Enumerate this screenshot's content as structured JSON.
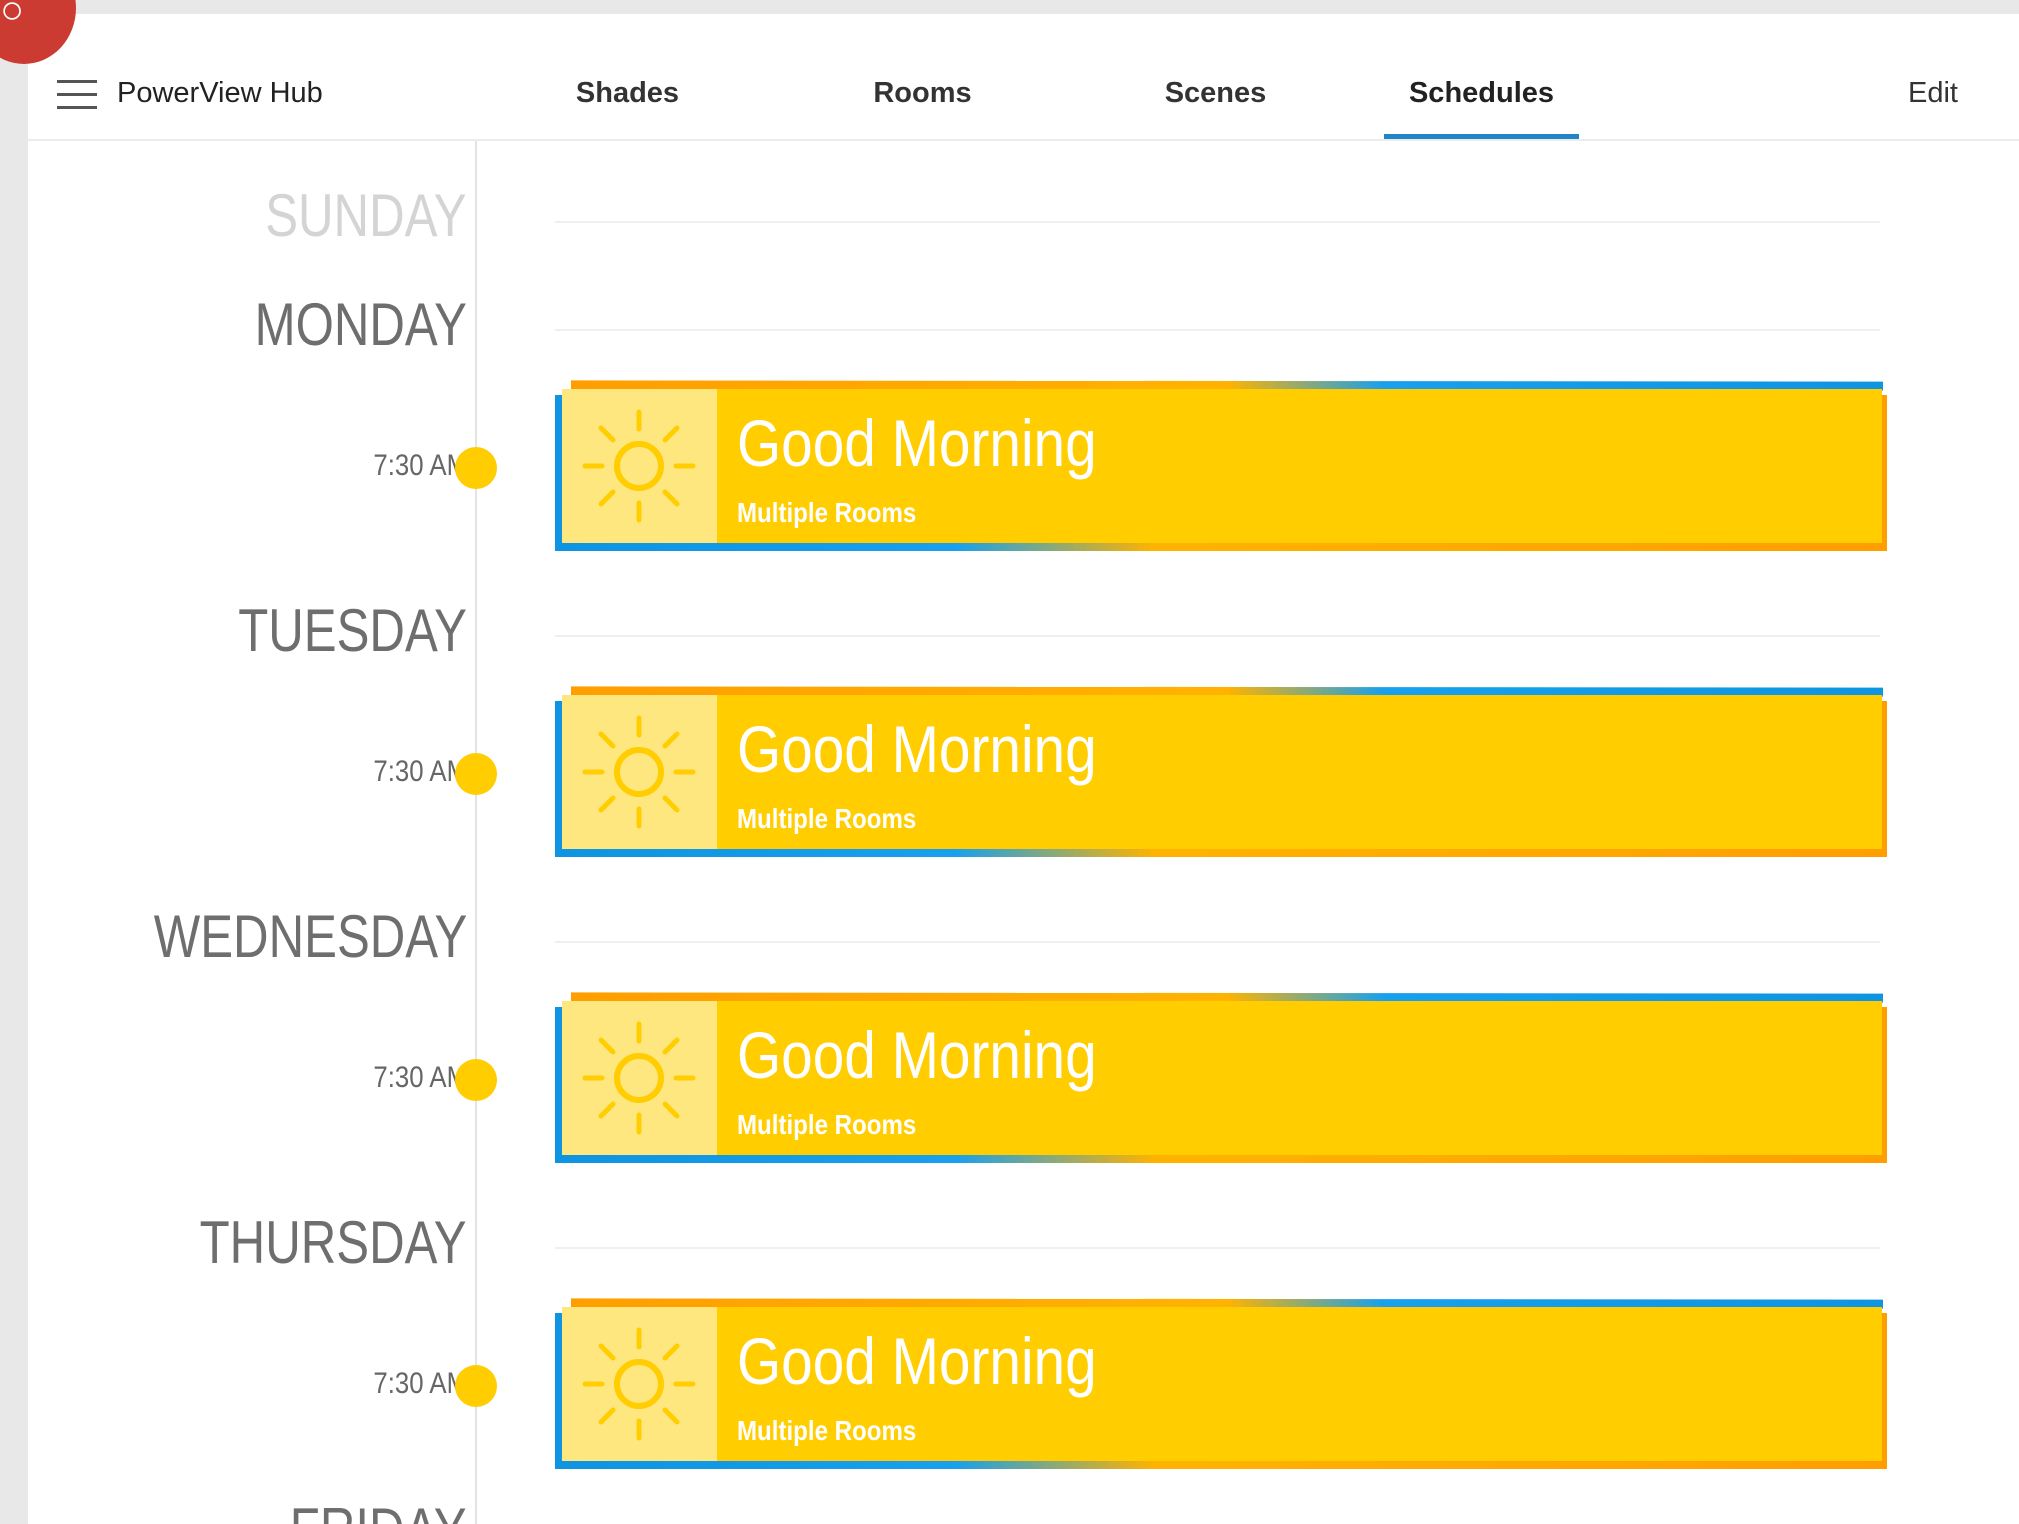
{
  "header": {
    "title": "PowerView Hub",
    "tabs": [
      {
        "label": "Shades"
      },
      {
        "label": "Rooms"
      },
      {
        "label": "Scenes"
      },
      {
        "label": "Schedules",
        "active": true
      }
    ],
    "edit_label": "Edit"
  },
  "colors": {
    "accent": "#1f85c4",
    "card": "#ffcd00",
    "card_icon_bg": "#ffe77f",
    "card_edge_orange": "#ff9e00",
    "card_edge_blue": "#0e94e0"
  },
  "schedule": {
    "days": [
      {
        "name": "SUNDAY",
        "events": []
      },
      {
        "name": "MONDAY",
        "events": [
          {
            "time": "7:30 AM",
            "title": "Good Morning",
            "subtitle": "Multiple Rooms",
            "icon": "sun-icon"
          }
        ]
      },
      {
        "name": "TUESDAY",
        "events": [
          {
            "time": "7:30 AM",
            "title": "Good Morning",
            "subtitle": "Multiple Rooms",
            "icon": "sun-icon"
          }
        ]
      },
      {
        "name": "WEDNESDAY",
        "events": [
          {
            "time": "7:30 AM",
            "title": "Good Morning",
            "subtitle": "Multiple Rooms",
            "icon": "sun-icon"
          }
        ]
      },
      {
        "name": "THURSDAY",
        "events": [
          {
            "time": "7:30 AM",
            "title": "Good Morning",
            "subtitle": "Multiple Rooms",
            "icon": "sun-icon"
          }
        ]
      },
      {
        "name": "FRIDAY",
        "events": []
      }
    ]
  }
}
